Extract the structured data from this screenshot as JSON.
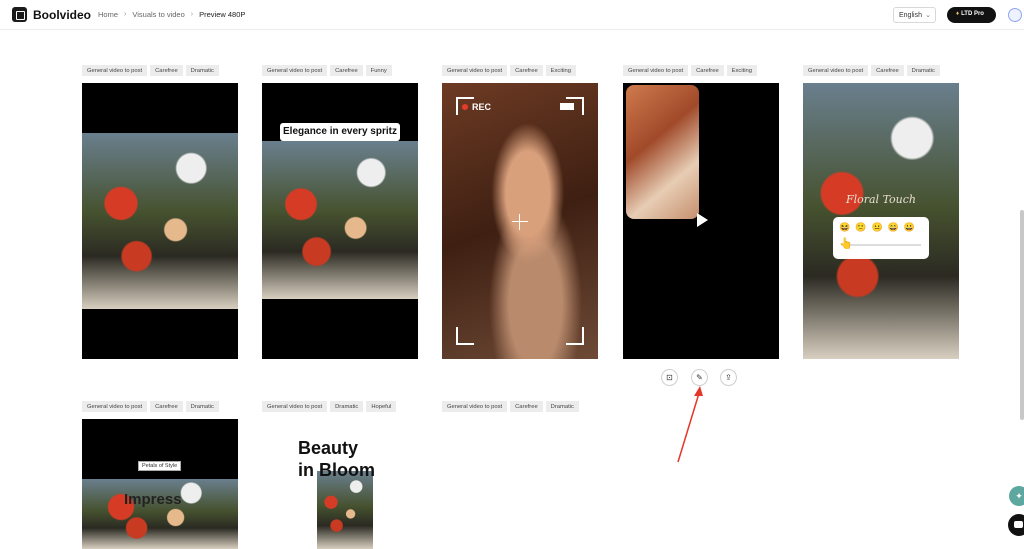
{
  "header": {
    "brand": "Boolvideo",
    "breadcrumb": [
      "Home",
      "Visuals to video",
      "Preview 480P"
    ],
    "language": "English",
    "ltd_label": "LTD Pro"
  },
  "cards": [
    {
      "tags": [
        "General video to post",
        "Carefree",
        "Dramatic"
      ]
    },
    {
      "tags": [
        "General video to post",
        "Carefree",
        "Funny"
      ],
      "caption": "Elegance in every spritz"
    },
    {
      "tags": [
        "General video to post",
        "Carefree",
        "Exciting"
      ],
      "rec_label": "REC"
    },
    {
      "tags": [
        "General video to post",
        "Carefree",
        "Exciting"
      ]
    },
    {
      "tags": [
        "General video to post",
        "Carefree",
        "Dramatic"
      ],
      "overlay_script": "Floral Touch",
      "emojis": [
        "😆",
        "🙁",
        "😐",
        "😄",
        "😀"
      ],
      "pointer": "👆"
    },
    {
      "tags": [
        "General video to post",
        "Carefree",
        "Dramatic"
      ],
      "small_label": "Petals of Style",
      "big_text": "Impress"
    },
    {
      "tags": [
        "General video to post",
        "Dramatic",
        "Hopeful"
      ],
      "headline": [
        "Beauty",
        "in Bloom"
      ]
    },
    {
      "tags": [
        "General video to post",
        "Carefree",
        "Dramatic"
      ]
    }
  ],
  "actions": {
    "icons": [
      "folder-icon",
      "edit-icon",
      "share-icon"
    ]
  },
  "colors": {
    "accent_arrow": "#e5362a",
    "ltd_bg": "#111111",
    "tag_bg": "#ececec"
  }
}
